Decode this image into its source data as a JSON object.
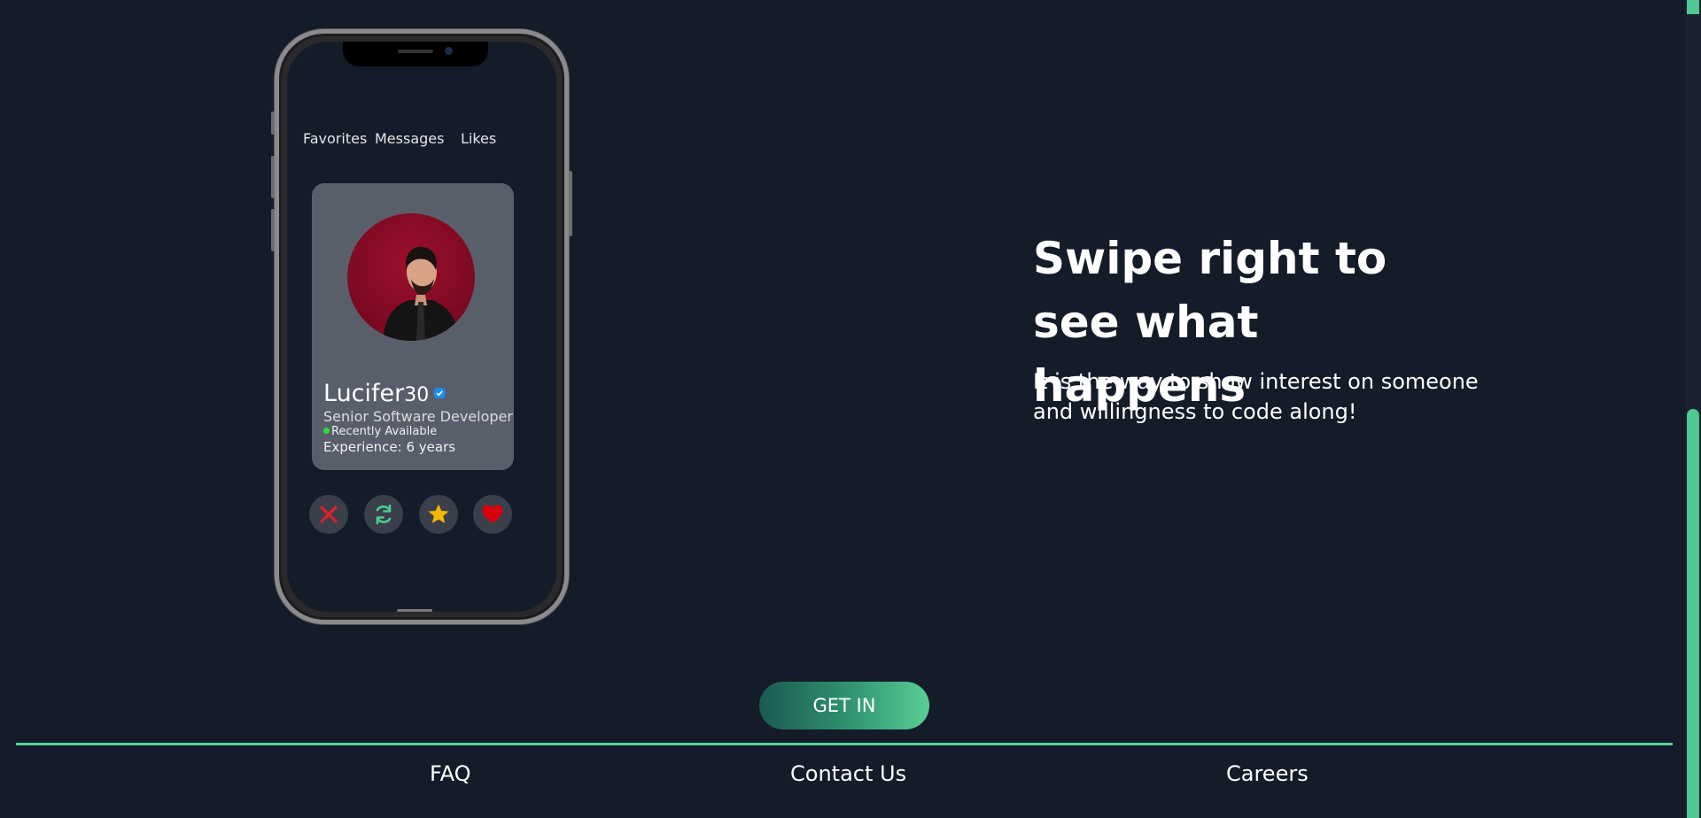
{
  "phone": {
    "nav": {
      "favorites": "Favorites",
      "messages": "Messages",
      "likes": "Likes"
    },
    "profile": {
      "name": "Lucifer",
      "age": "30",
      "role": "Senior Software Developer",
      "status": "Recently Available",
      "experience": "Experience: 6 years"
    },
    "actions": {
      "reject_icon": "x-icon",
      "rewind_icon": "refresh-icon",
      "super_like_icon": "star-icon",
      "like_icon": "heart-icon"
    }
  },
  "hero": {
    "title": "Swipe right to see what happens",
    "description": "It is the way to show interest on someone and willingness to code along!"
  },
  "cta": {
    "label": "GET IN"
  },
  "footer": {
    "faq": "FAQ",
    "contact": "Contact Us",
    "careers": "Careers"
  },
  "colors": {
    "background": "#141b29",
    "accent": "#56d29a",
    "card": "#595e6b",
    "reject": "#e0202a",
    "star": "#f5b800",
    "heart": "#d8000c"
  }
}
